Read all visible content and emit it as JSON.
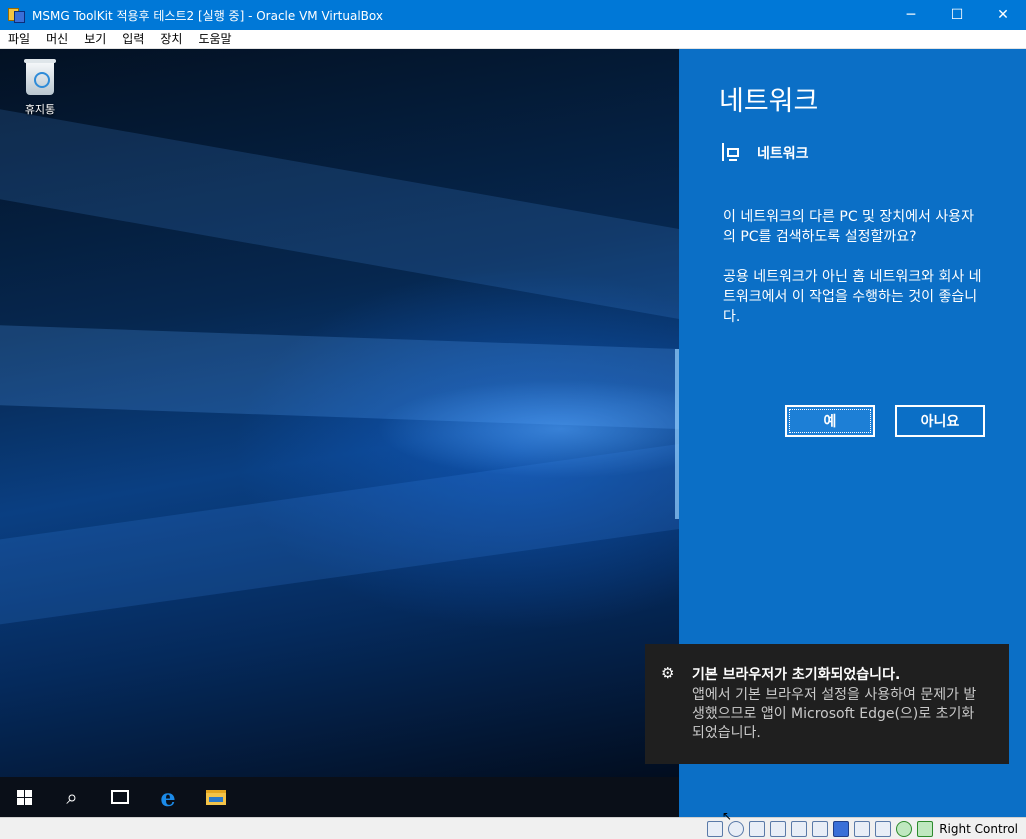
{
  "window": {
    "title": "MSMG ToolKit 적용후 테스트2 [실행 중] - Oracle VM VirtualBox",
    "controls": {
      "minimize": "─",
      "maximize": "☐",
      "close": "✕"
    }
  },
  "menu": [
    "파일",
    "머신",
    "보기",
    "입력",
    "장치",
    "도움말"
  ],
  "desktop": {
    "icons": [
      {
        "label": "휴지통",
        "icon": "recycle-bin-icon"
      }
    ]
  },
  "taskbar": {
    "items": [
      "start-icon",
      "search-icon",
      "task-view-icon",
      "edge-icon",
      "file-explorer-icon"
    ],
    "search_glyph": "⌕"
  },
  "network_panel": {
    "heading": "네트워크",
    "network_name": "네트워크",
    "question": "이 네트워크의 다른 PC 및 장치에서 사용자의 PC를 검색하도록 설정할까요?",
    "advice": "공용 네트워크가 아닌 홈 네트워크와 회사 네트워크에서 이 작업을 수행하는 것이 좋습니다.",
    "yes_label": "예",
    "no_label": "아니요",
    "colors": {
      "background": "#0b6fc6",
      "text": "#ffffff"
    }
  },
  "toast": {
    "icon": "gear-icon",
    "glyph": "⚙",
    "title": "기본 브라우저가 초기화되었습니다.",
    "body": "앱에서 기본 브라우저 설정을 사용하여 문제가 발생했으므로 앱이 Microsoft Edge(으)로 초기화되었습니다."
  },
  "statusbar": {
    "icons": [
      "hard-disk-icon",
      "optical-drive-icon",
      "audio-icon",
      "network-adapter-icon",
      "usb-icon",
      "shared-folder-icon",
      "display-icon",
      "video-capture-icon",
      "recording-icon",
      "mouse-integration-icon",
      "keyboard-capture-icon"
    ],
    "host_key": "Right Control"
  }
}
